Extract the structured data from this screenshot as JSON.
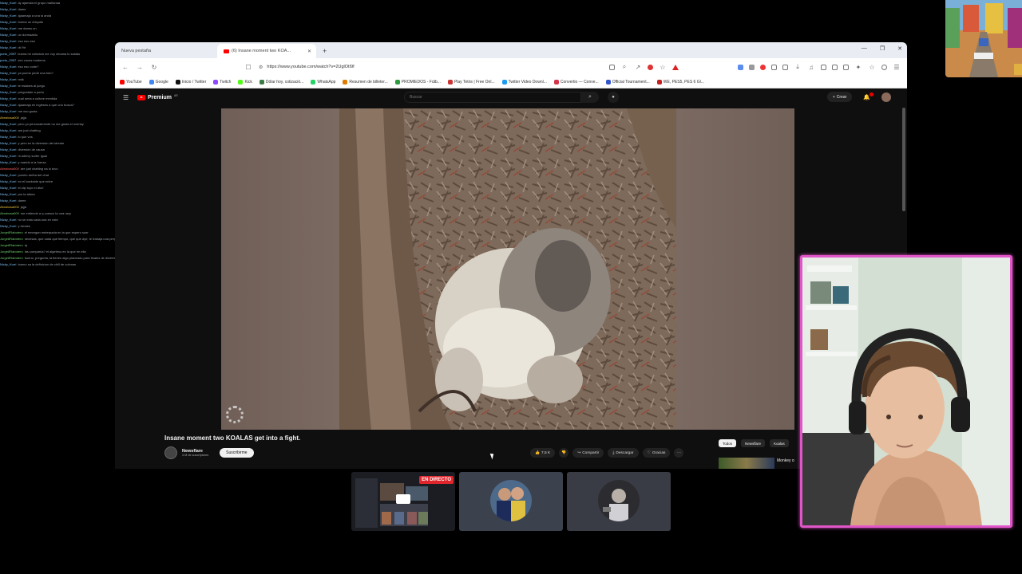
{
  "chat": {
    "lines": [
      {
        "user": "Nicky_Kurri",
        "msg": "ay ajamaia el grupo mañanaa",
        "color": "blue"
      },
      {
        "user": "Nicky_Kurri",
        "msg": "dame",
        "color": "blue"
      },
      {
        "user": "Nicky_Kurri",
        "msg": "ajaamaja a una la anda",
        "color": "blue"
      },
      {
        "user": "Nicky_Kurri",
        "msg": "buena un chiquito",
        "color": "blue"
      },
      {
        "user": "Nicky_Kurri",
        "msg": "me danes un",
        "color": "blue"
      },
      {
        "user": "Nicky_Kurri",
        "msg": "un dormaaldo",
        "color": "blue"
      },
      {
        "user": "Nicky_Kurri",
        "msg": "eso eso eso",
        "color": "blue"
      },
      {
        "user": "Nicky_Kurri",
        "msg": "dt lYe",
        "color": "blue"
      },
      {
        "user": "porto_2097",
        "msg": "buena mi colmado me voy chuana lo saldas",
        "color": "gray"
      },
      {
        "user": "porto_2097",
        "msg": "ven voces modems",
        "color": "gray"
      },
      {
        "user": "Nicky_Kurri",
        "msg": "eso eso code?",
        "color": "blue"
      },
      {
        "user": "Nicky_Kurri",
        "msg": "ya puedo pedir una foto?",
        "color": "blue"
      },
      {
        "user": "Nicky_Kurri",
        "msg": "nnlk",
        "color": "blue"
      },
      {
        "user": "Nicky_Kurri",
        "msg": "te estabes al juego",
        "color": "blue"
      },
      {
        "user": "Nicky_Kurri",
        "msg": "preguntale a porto",
        "color": "blue"
      },
      {
        "user": "Nicky_Kurri",
        "msg": "cual seria a culture mentida",
        "color": "blue"
      },
      {
        "user": "Nicky_Kurri",
        "msg": "ajaamaja en ingleses a que uno busca?",
        "color": "blue"
      },
      {
        "user": "Nicky_Kurri",
        "msg": "me oso gusta",
        "color": "blue"
      },
      {
        "user": "Abrabosa000",
        "msg": "jajja",
        "color": "yellow"
      },
      {
        "user": "Nicky_Kurri",
        "msg": "pero yo personalmente no me gusta el overlay",
        "color": "blue"
      },
      {
        "user": "Nicky_Kurri",
        "msg": "are just chatting",
        "color": "blue"
      },
      {
        "user": "Nicky_Kurri",
        "msg": "lo que vos",
        "color": "blue"
      },
      {
        "user": "Nicky_Kurri",
        "msg": "y pero en la diversion del stream",
        "color": "blue"
      },
      {
        "user": "Nicky_Kurri",
        "msg": "diversión de causa",
        "color": "blue"
      },
      {
        "user": "Nicky_Kurri",
        "msg": "ni adinvy surfer igual",
        "color": "blue"
      },
      {
        "user": "Nicky_Kurri",
        "msg": "y marido a la fuerza",
        "color": "blue"
      },
      {
        "user": "Abrabosa000",
        "msg": "are just chatting na lo tuvo",
        "color": "red"
      },
      {
        "user": "Nicky_Kurri",
        "msg": "ponelo arriba del chat",
        "color": "blue"
      },
      {
        "user": "Nicky_Kurri",
        "msg": "en el backside que entre",
        "color": "blue"
      },
      {
        "user": "Nicky_Kurri",
        "msg": "el clip tuyo el aho!",
        "color": "blue"
      },
      {
        "user": "Nicky_Kurri",
        "msg": "por la altura",
        "color": "blue"
      },
      {
        "user": "Nicky_Kurri",
        "msg": "dame",
        "color": "blue"
      },
      {
        "user": "Abrabosa000",
        "msg": "jajja",
        "color": "yellow"
      },
      {
        "user": "Abrabosa000",
        "msg": "me entiende a q cuesco la una razy",
        "color": "green"
      },
      {
        "user": "Nicky_Kurri",
        "msg": "no se esta cada una en este",
        "color": "blue"
      },
      {
        "user": "Nicky_Kurri",
        "msg": "y treotes",
        "color": "blue"
      },
      {
        "user": "Jorge8Rabotero",
        "msg": "el emergan meterpada en la que espero suer",
        "color": "green"
      },
      {
        "user": "Jorge8Rabotero",
        "msg": "necesas, que cada que tiempo, que que aye, te trabaja una pregunta y una propuesta",
        "color": "green"
      },
      {
        "user": "Jorge8Rabotero",
        "msg": "aj",
        "color": "green"
      },
      {
        "user": "Jorge8Rabotero",
        "msg": "las companía? el algeteso en la que en ella",
        "color": "green"
      },
      {
        "user": "Jorge8Rabotero",
        "msg": "bueno, pregunta, la tienen algo planeado para finales de diciembre? algo en comunidad, o esas fechas las tienes congeladas?",
        "color": "green"
      },
      {
        "user": "Nicky_Kurri",
        "msg": "bueno sa la definicion de chill de colonas",
        "color": "blue"
      }
    ]
  },
  "browser": {
    "tabs": [
      {
        "label": "Nueva pestaña",
        "active": false
      },
      {
        "label": "(6) Insane moment two KOA...",
        "active": true
      }
    ],
    "url": "https://www.youtube.com/watch?v=2UglOtI9f",
    "bookmarks": [
      {
        "label": "YouTube",
        "color": "#ff0000"
      },
      {
        "label": "Google",
        "color": "#4285f4"
      },
      {
        "label": "Inicio / Twitter",
        "color": "#111111"
      },
      {
        "label": "Twitch",
        "color": "#9146ff"
      },
      {
        "label": "Kick",
        "color": "#53fc18"
      },
      {
        "label": "Dólar hoy, cotizació...",
        "color": "#3a7d44"
      },
      {
        "label": "WhatsApp",
        "color": "#25d366"
      },
      {
        "label": "Resumen de billeter...",
        "color": "#e07b00"
      },
      {
        "label": "PROMIEDOS - Fútb...",
        "color": "#2e9a3e"
      },
      {
        "label": "Play Tetris | Free Onl...",
        "color": "#cc3333"
      },
      {
        "label": "Twitter Video Downl...",
        "color": "#1d9bf0"
      },
      {
        "label": "Convertio — Conve...",
        "color": "#d6334a"
      },
      {
        "label": "Official Tournament...",
        "color": "#3355cc"
      },
      {
        "label": "WE, PES5, PES 6 Gl...",
        "color": "#c42020"
      }
    ]
  },
  "youtube": {
    "logo": "Premium",
    "logo_sup": "AR",
    "search_placeholder": "Buscar",
    "create_label": "Crear",
    "video": {
      "title": "Insane moment two KOALAS get into a fight.",
      "channel": "Newsflare",
      "subscribers": "4 M de suscriptores",
      "subscribe_label": "Suscribirme",
      "likes": "7,5 K",
      "share_label": "Compartir",
      "download_label": "Descargar",
      "thanks_label": "Gracias"
    },
    "chips": [
      {
        "label": "Todos",
        "active": true
      },
      {
        "label": "Newsflare",
        "active": false
      },
      {
        "label": "Koalas",
        "active": false
      }
    ],
    "recommended": {
      "title": "Monkey co"
    }
  },
  "previews": {
    "live_label": "EN DIRECTO"
  }
}
